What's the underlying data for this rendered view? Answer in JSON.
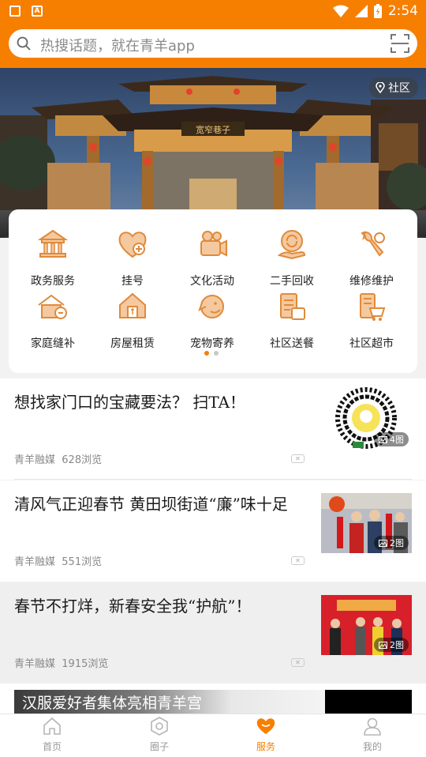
{
  "status_bar": {
    "time": "2:54"
  },
  "search": {
    "placeholder": "热搜话题，就在青羊app"
  },
  "banner": {
    "location_label": "社区",
    "gate_sign": "宽窄巷子"
  },
  "services": {
    "items": [
      {
        "label": "政务服务",
        "icon": "government-building-icon"
      },
      {
        "label": "挂号",
        "icon": "heart-plus-icon"
      },
      {
        "label": "文化活动",
        "icon": "camera-activity-icon"
      },
      {
        "label": "二手回收",
        "icon": "recycle-hand-icon"
      },
      {
        "label": "维修维护",
        "icon": "wrench-icon"
      },
      {
        "label": "家庭缝补",
        "icon": "sewing-home-icon"
      },
      {
        "label": "房屋租赁",
        "icon": "house-rent-icon"
      },
      {
        "label": "宠物寄养",
        "icon": "pet-dog-icon"
      },
      {
        "label": "社区送餐",
        "icon": "meal-delivery-icon"
      },
      {
        "label": "社区超市",
        "icon": "supermarket-icon"
      }
    ],
    "page_count": 2,
    "active_page": 1
  },
  "feed": {
    "items": [
      {
        "title": "想找家门口的宝藏要法？  扫TA！",
        "source": "青羊融媒",
        "views": "628浏览",
        "pics": "4图"
      },
      {
        "title": "清风气正迎春节  黄田坝街道“廉”味十足",
        "source": "青羊融媒",
        "views": "551浏览",
        "pics": "2图"
      },
      {
        "title": "春节不打烊，新春安全我“护航”！",
        "source": "青羊融媒",
        "views": "1915浏览",
        "pics": "2图"
      }
    ],
    "video_title": "汉服爱好者集体亮相青羊宫"
  },
  "tabbar": {
    "tabs": [
      {
        "label": "首页",
        "icon": "home-icon"
      },
      {
        "label": "圈子",
        "icon": "circle-hexagon-icon"
      },
      {
        "label": "服务",
        "icon": "heart-service-icon"
      },
      {
        "label": "我的",
        "icon": "person-icon"
      }
    ],
    "active_index": 2
  },
  "colors": {
    "brand": "#f77f00",
    "icon_fill": "#f5c9a0",
    "icon_stroke": "#e08a3a"
  }
}
